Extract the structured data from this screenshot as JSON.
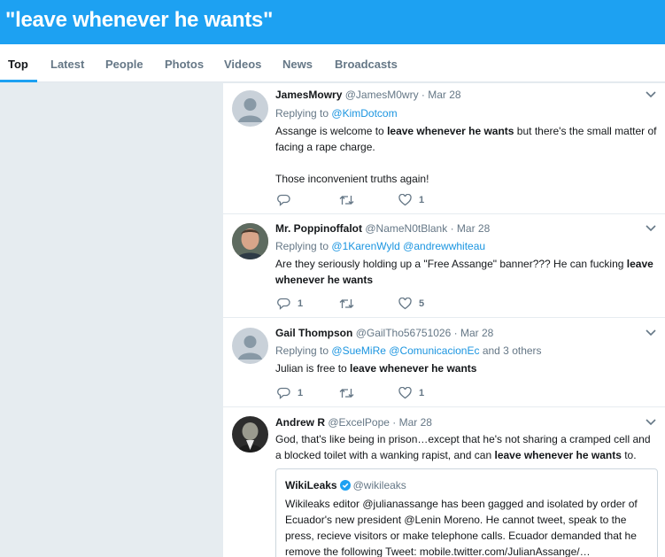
{
  "header": {
    "title": "\"leave whenever he wants\""
  },
  "tabs": [
    {
      "label": "Top"
    },
    {
      "label": "Latest"
    },
    {
      "label": "People"
    },
    {
      "label": "Photos"
    },
    {
      "label": "Videos"
    },
    {
      "label": "News"
    },
    {
      "label": "Broadcasts"
    }
  ],
  "tweets": [
    {
      "name": "JamesMowry",
      "handle": "@JamesM0wry",
      "date": "· Mar 28",
      "replying_prefix": "Replying to",
      "replying_to": "@KimDotcom",
      "text_1a": "Assange is welcome to ",
      "text_1b": "leave whenever he wants",
      "text_1c": " but there's the small matter of facing a rape charge.",
      "text_2": "Those inconvenient truths again!",
      "reply_count": "",
      "retweet_count": "",
      "like_count": "1"
    },
    {
      "name": "Mr. Poppinoffalot",
      "handle": "@NameN0tBlank",
      "date": "· Mar 28",
      "replying_prefix": "Replying to",
      "replying_to": "@1KarenWyld @andrewwhiteau",
      "text_1a": "Are they seriously holding up a \"Free Assange\" banner??? He can fucking ",
      "text_1b": "leave whenever he wants",
      "reply_count": "1",
      "retweet_count": "",
      "like_count": "5"
    },
    {
      "name": "Gail Thompson",
      "handle": "@GailTho56751026",
      "date": "· Mar 28",
      "replying_prefix": "Replying to",
      "replying_to": "@SueMiRe @ComunicacionEc",
      "replying_suffix": "and 3 others",
      "text_1a": "Julian is free to ",
      "text_1b": "leave whenever he wants",
      "reply_count": "1",
      "retweet_count": "",
      "like_count": "1"
    },
    {
      "name": "Andrew R",
      "handle": "@ExcelPope",
      "date": "· Mar 28",
      "text_1a": "God, that's like being in prison…except that he's not sharing a cramped cell and a blocked toilet with a wanking rapist, and can ",
      "text_1b": "leave whenever he wants",
      "text_1c": " to.",
      "quote": {
        "name": "WikiLeaks",
        "handle": "@wikileaks",
        "text": "Wikileaks editor @julianassange has been gagged and isolated by order of Ecuador's new president @Lenin Moreno. He cannot tweet, speak to the press, recieve visitors or make telephone calls. Ecuador demanded that he remove the following Tweet: mobile.twitter.com/JulianAssange/…"
      }
    }
  ],
  "colors": {
    "brand": "#1da1f2",
    "link": "#1b95e0",
    "muted": "#657786"
  },
  "icons": {
    "reply": "reply-icon",
    "retweet": "retweet-icon",
    "like": "heart-icon",
    "caret": "chevron-down-icon",
    "verified": "verified-badge-icon"
  }
}
